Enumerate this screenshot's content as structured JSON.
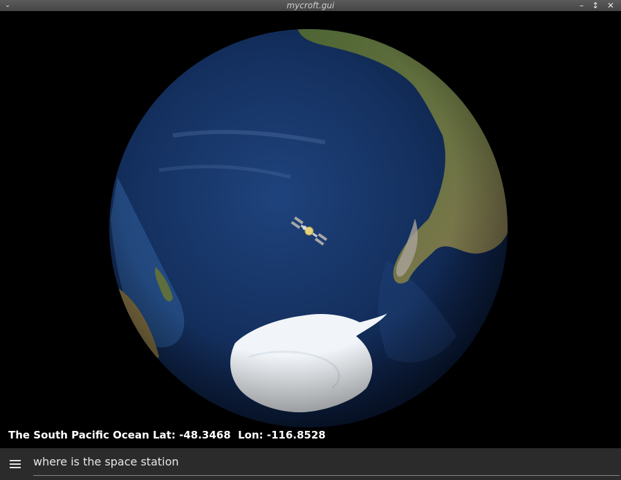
{
  "window": {
    "title": "mycroft.gui",
    "menu_icon": "chevron-down-icon",
    "minimize_icon": "minimize-icon",
    "maximize_icon": "maximize-icon",
    "close_icon": "close-icon"
  },
  "map": {
    "globe_icon": "earth-globe",
    "satellite_icon": "iss-satellite-icon"
  },
  "location": {
    "place": "The South Pacific Ocean",
    "lat_label": "Lat:",
    "lat": "-48.3468",
    "lon_label": "Lon:",
    "lon": "-116.8528"
  },
  "input": {
    "menu_icon": "hamburger-menu-icon",
    "value": "where is the space station"
  },
  "colors": {
    "ocean_deep": "#0c1e45",
    "ocean_light": "#2c5a97",
    "land": "#566b3a",
    "ice": "#f2f6fa",
    "bar": "#2b2b2b"
  }
}
